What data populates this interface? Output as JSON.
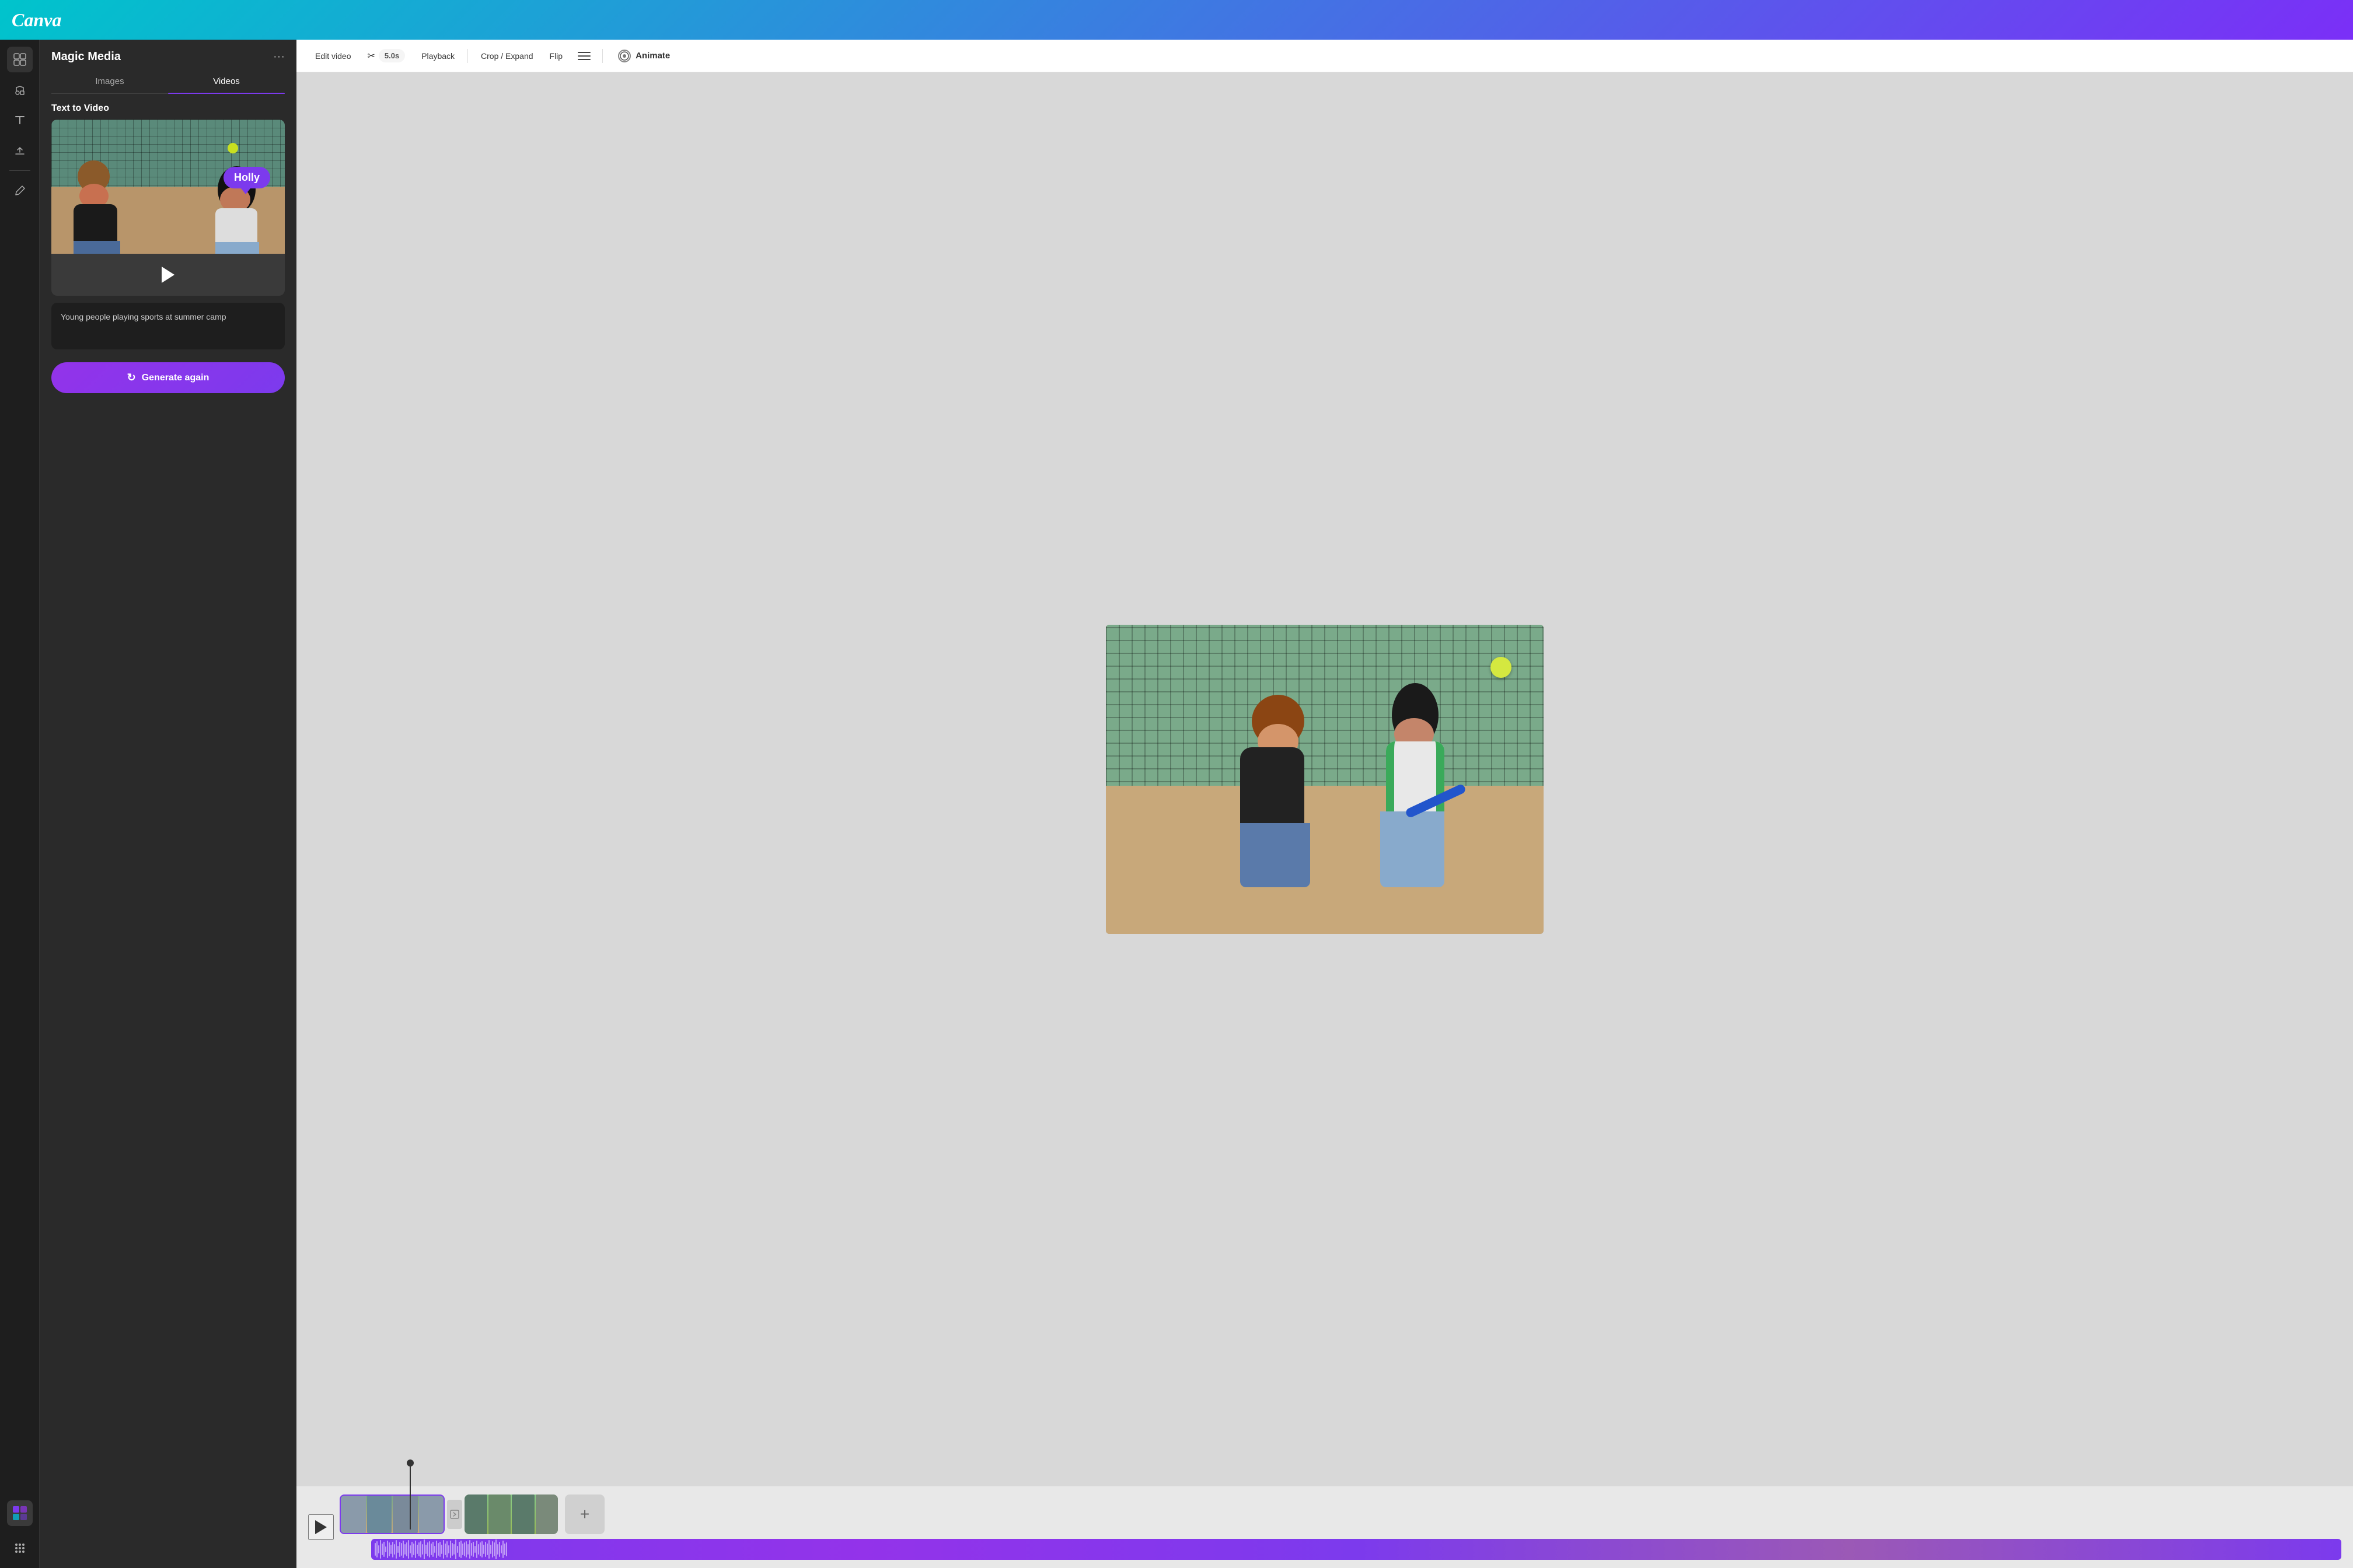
{
  "app": {
    "title": "Canva"
  },
  "toolbar": {
    "edit_video_label": "Edit video",
    "duration_label": "5.0s",
    "playback_label": "Playback",
    "crop_expand_label": "Crop / Expand",
    "flip_label": "Flip",
    "animate_label": "Animate"
  },
  "left_panel": {
    "title": "Magic Media",
    "tabs": [
      "Images",
      "Videos"
    ],
    "active_tab": "Videos",
    "section_label": "Text to Video",
    "prompt_text": "Young people playing sports at summer camp",
    "generate_btn_label": "Generate again",
    "tooltip_label": "Holly"
  },
  "timeline": {
    "add_clip_label": "+"
  },
  "icons": {
    "layout_icon": "⊞",
    "elements_icon": "♡△",
    "text_icon": "T",
    "upload_icon": "↑",
    "draw_icon": "✏",
    "apps_icon": "⋮⋮⋮",
    "more_icon": "···",
    "scissors_icon": "✂",
    "hamburger_icon": "≡",
    "animate_icon": "◎",
    "play_icon": "▶",
    "refresh_icon": "↻"
  },
  "colors": {
    "primary_purple": "#7c3aed",
    "header_gradient_start": "#00c4cc",
    "header_gradient_end": "#7b2ff7",
    "sidebar_bg": "#1e1e1e",
    "panel_bg": "#2a2a2a"
  }
}
